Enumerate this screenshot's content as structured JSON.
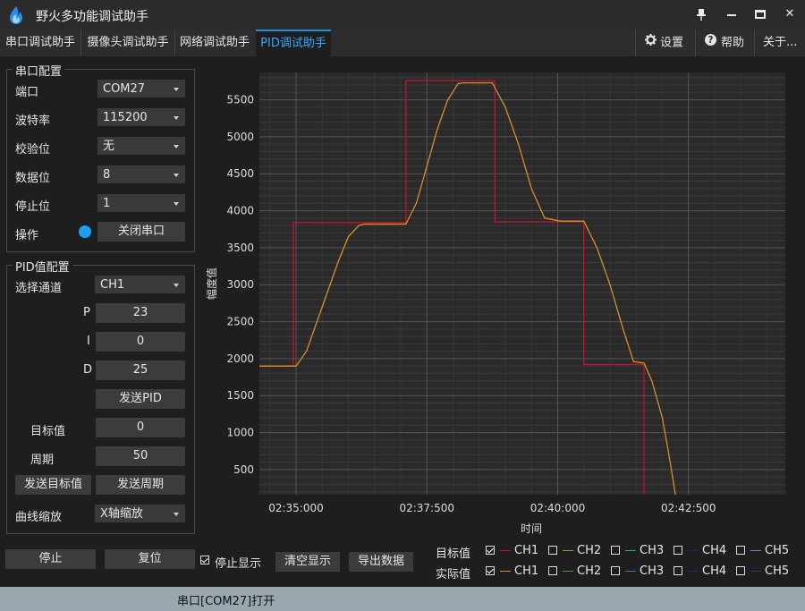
{
  "app": {
    "title": "野火多功能调试助手"
  },
  "tabs": [
    "串口调试助手",
    "摄像头调试助手",
    "网络调试助手",
    "PID调试助手"
  ],
  "toolbar": {
    "settings": "设置",
    "help": "帮助",
    "about": "关于..."
  },
  "serial": {
    "group_title": "串口配置",
    "port_label": "端口",
    "port_value": "COM27",
    "baud_label": "波特率",
    "baud_value": "115200",
    "parity_label": "校验位",
    "parity_value": "无",
    "databits_label": "数据位",
    "databits_value": "8",
    "stopbits_label": "停止位",
    "stopbits_value": "1",
    "op_label": "操作",
    "close_button": "关闭串口"
  },
  "pid": {
    "group_title": "PID值配置",
    "channel_label": "选择通道",
    "channel_value": "CH1",
    "p_label": "P",
    "p_value": "23",
    "i_label": "I",
    "i_value": "0",
    "d_label": "D",
    "d_value": "25",
    "send_pid": "发送PID",
    "target_label": "目标值",
    "target_value": "0",
    "period_label": "周期",
    "period_value": "50",
    "send_target": "发送目标值",
    "send_period": "发送周期",
    "zoom_label": "曲线缩放",
    "zoom_value": "X轴缩放"
  },
  "bottom": {
    "stop": "停止",
    "reset": "复位",
    "stop_display": "停止显示",
    "clear_display": "清空显示",
    "export": "导出数据",
    "target_row_label": "目标值",
    "actual_row_label": "实际值"
  },
  "channels": {
    "names": [
      "CH1",
      "CH2",
      "CH3",
      "CH4",
      "CH5"
    ],
    "target_checked": [
      true,
      false,
      false,
      false,
      false
    ],
    "actual_checked": [
      true,
      false,
      false,
      false,
      false
    ],
    "target_colors": [
      "#c8102e",
      "#9a9a1a",
      "#18b0b0",
      "#1a2a5a",
      "#9a6ac8"
    ],
    "actual_colors": [
      "#d4902a",
      "#4a9a3a",
      "#2a7ad0",
      "#2a2a6a",
      "#3a2a8a"
    ]
  },
  "status": {
    "text": "串口[COM27]打开"
  },
  "chart_data": {
    "type": "line",
    "ylabel": "幅度值",
    "xlabel": "时间",
    "x_ticks": [
      "02:35:000",
      "02:37:500",
      "02:40:000",
      "02:42:500"
    ],
    "y_ticks": [
      500,
      1000,
      1500,
      2000,
      2500,
      3000,
      3500,
      4000,
      4500,
      5000,
      5500
    ],
    "ylim": [
      160,
      5870
    ],
    "xlim_seconds": [
      150.6,
      170.7
    ],
    "grid": true,
    "series": [
      {
        "name": "目标值 CH1",
        "color": "#c8102e",
        "x": [
          150.6,
          151.9,
          151.9,
          156.2,
          156.2,
          159.6,
          159.6,
          163.0,
          163.0,
          165.3,
          165.3
        ],
        "y": [
          1900,
          1900,
          3840,
          3840,
          5760,
          5760,
          3850,
          3850,
          1920,
          1920,
          0
        ]
      },
      {
        "name": "实际值 CH1",
        "color": "#d4902a",
        "x": [
          150.6,
          152.0,
          152.4,
          152.8,
          153.2,
          153.6,
          154.0,
          154.4,
          154.6,
          156.2,
          156.6,
          157.0,
          157.4,
          157.8,
          158.2,
          158.4,
          159.5,
          160.0,
          160.5,
          161.0,
          161.5,
          162.1,
          163.0,
          163.5,
          164.0,
          164.5,
          164.9,
          165.3,
          165.6,
          166.0,
          166.3,
          166.5
        ],
        "y": [
          1900,
          1900,
          2100,
          2500,
          2900,
          3300,
          3650,
          3800,
          3820,
          3820,
          4100,
          4600,
          5100,
          5500,
          5720,
          5730,
          5730,
          5400,
          4900,
          4300,
          3900,
          3860,
          3860,
          3500,
          3000,
          2400,
          1960,
          1940,
          1700,
          1200,
          600,
          160
        ]
      }
    ]
  }
}
